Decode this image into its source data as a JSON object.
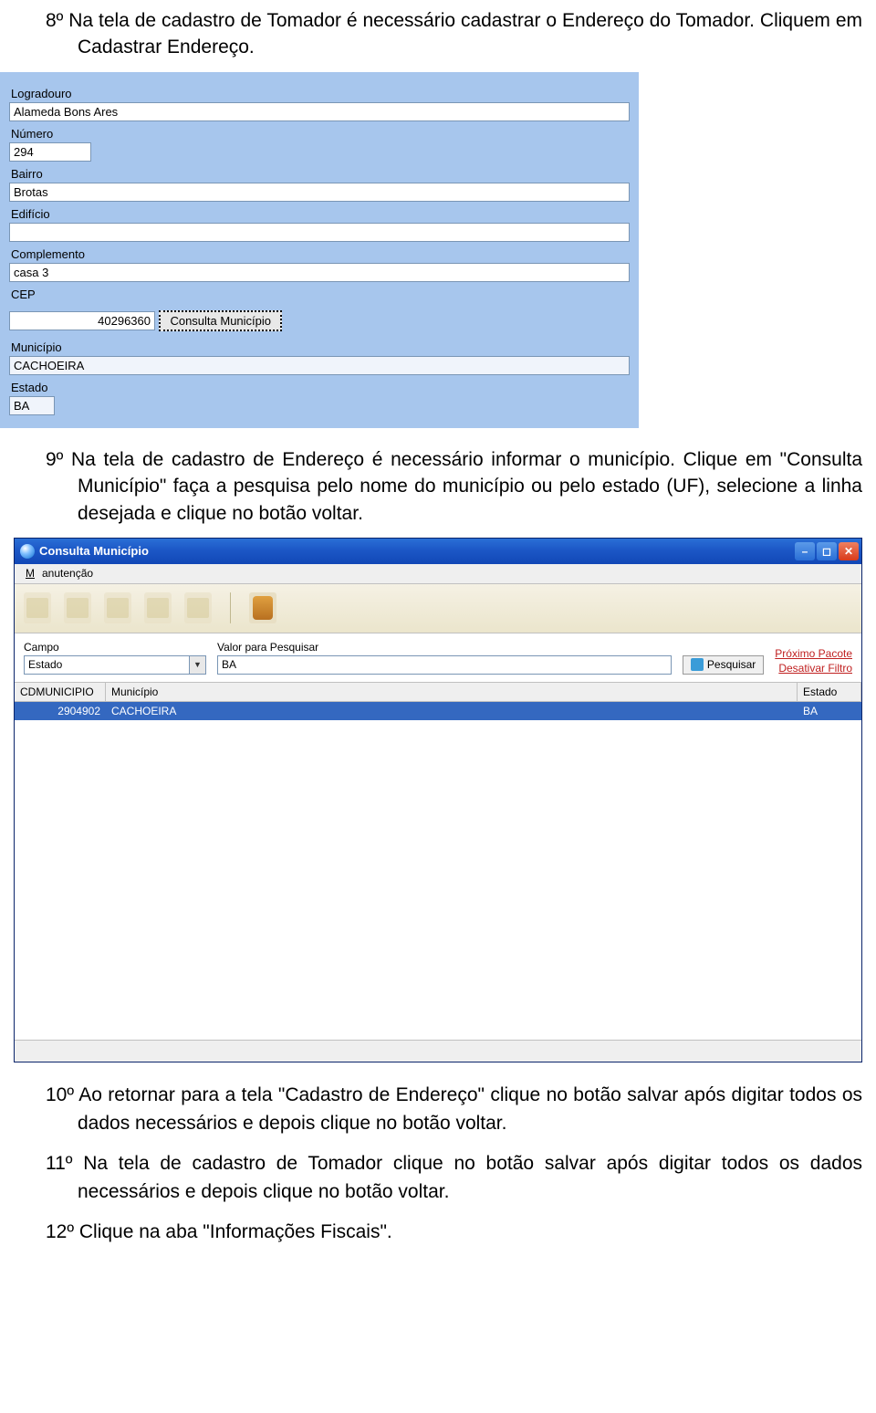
{
  "texts": {
    "intro_8": "8º Na tela de cadastro de Tomador é necessário cadastrar o Endereço do Tomador. Cliquem em Cadastrar Endereço.",
    "intro_9": "9º Na tela de cadastro de Endereço é necessário informar o município. Clique em \"Consulta Município\" faça a pesquisa pelo nome do município ou pelo estado (UF), selecione a linha desejada e clique no botão voltar.",
    "step_10": "10º Ao retornar para a tela \"Cadastro de Endereço\" clique no botão salvar após digitar todos os dados necessários e depois clique no botão voltar.",
    "step_11": "11º Na tela de cadastro de Tomador clique no botão salvar após digitar todos os dados necessários e depois clique no botão voltar.",
    "step_12": "12º Clique na aba \"Informações Fiscais\"."
  },
  "form": {
    "labels": {
      "logradouro": "Logradouro",
      "numero": "Número",
      "bairro": "Bairro",
      "edificio": "Edifício",
      "complemento": "Complemento",
      "cep": "CEP",
      "municipio": "Município",
      "estado": "Estado"
    },
    "values": {
      "logradouro": "Alameda Bons Ares",
      "numero": "294",
      "bairro": "Brotas",
      "edificio": "",
      "complemento": "casa 3",
      "cep": "40296360",
      "municipio": "CACHOEIRA",
      "estado": "BA"
    },
    "btn_consulta": "Consulta Município"
  },
  "window": {
    "title": "Consulta Município",
    "menu_manutencao": "Manutenção",
    "search": {
      "campo_label": "Campo",
      "campo_value": "Estado",
      "valor_label": "Valor para Pesquisar",
      "valor_value": "BA",
      "pesquisar": "Pesquisar",
      "link1": "Próximo Pacote",
      "link2": "Desativar Filtro"
    },
    "grid": {
      "col1": "CDMUNICIPIO",
      "col2": "Município",
      "col3": "Estado",
      "row": {
        "code": "2904902",
        "name": "CACHOEIRA",
        "state": "BA"
      }
    }
  }
}
